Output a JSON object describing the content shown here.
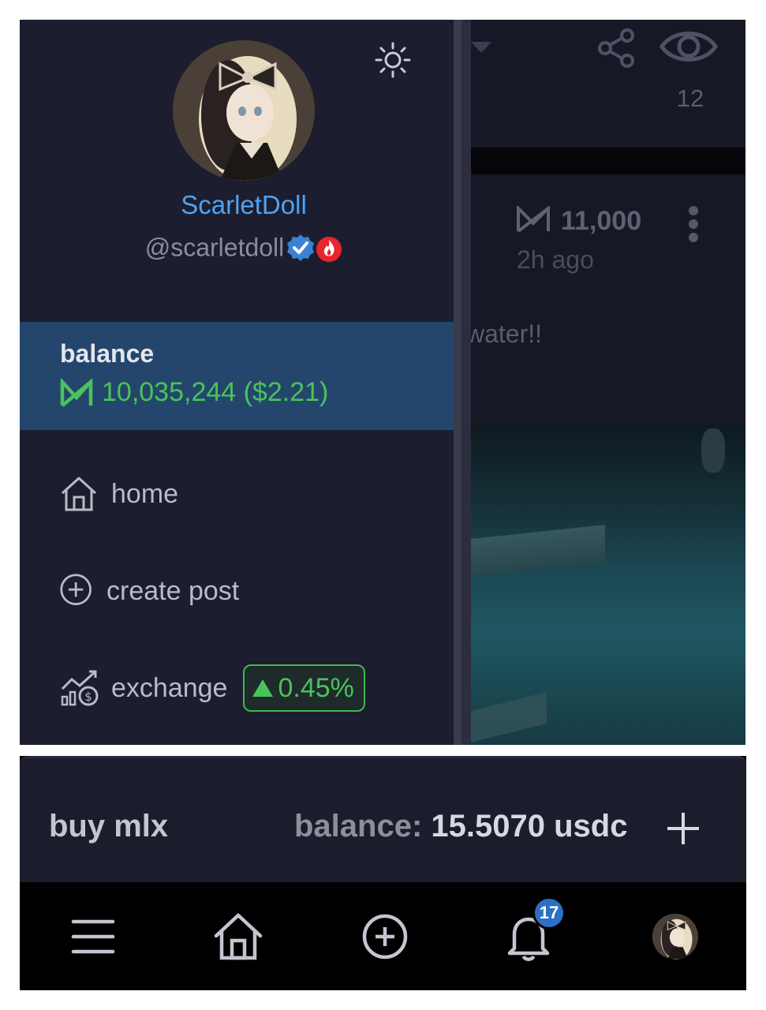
{
  "profile": {
    "display_name": "ScarletDoll",
    "handle": "@scarletdoll",
    "avatar_icon": "anime-doll-avatar",
    "verified_icon": "verified-badge-icon",
    "fire_icon": "fire-badge-icon"
  },
  "balance": {
    "label": "balance",
    "value": "10,035,244 ($2.21)",
    "icon": "mlx-token-icon"
  },
  "nav": {
    "items": [
      {
        "label": "home",
        "icon": "home-icon"
      },
      {
        "label": "create post",
        "icon": "plus-circle-icon"
      },
      {
        "label": "exchange",
        "icon": "exchange-chart-icon",
        "change": "0.45%",
        "trend": "up"
      }
    ]
  },
  "feed": {
    "view_count": "12",
    "post_price": "11,000",
    "post_time": "2h ago",
    "post_text": "water!!"
  },
  "buy_bar": {
    "title": "buy mlx",
    "balance_label": "balance:",
    "balance_value": "15.5070 usdc"
  },
  "bottom_nav": {
    "notification_count": "17"
  },
  "colors": {
    "accent_blue": "#4ea3f5",
    "positive_green": "#49c35c",
    "balance_bg": "#24466c",
    "drawer_bg": "#1c1d2e"
  }
}
